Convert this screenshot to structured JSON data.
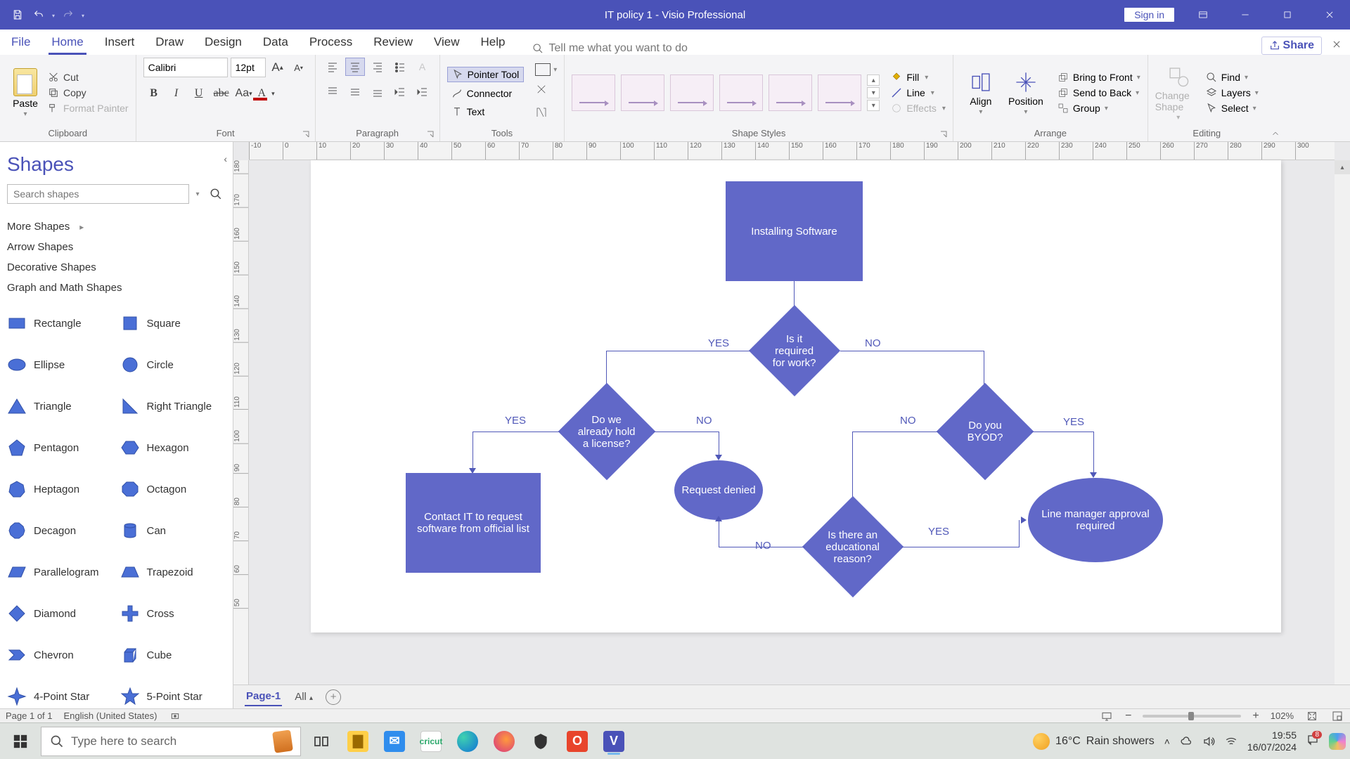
{
  "titlebar": {
    "doc_title": "IT policy 1  -  Visio Professional",
    "signin": "Sign in"
  },
  "tabs": {
    "file": "File",
    "home": "Home",
    "insert": "Insert",
    "draw": "Draw",
    "design": "Design",
    "data": "Data",
    "process": "Process",
    "review": "Review",
    "view": "View",
    "help": "Help",
    "tell_me_placeholder": "Tell me what you want to do",
    "share": "Share"
  },
  "ribbon": {
    "clipboard": {
      "label": "Clipboard",
      "paste": "Paste",
      "cut": "Cut",
      "copy": "Copy",
      "format_painter": "Format Painter"
    },
    "font": {
      "label": "Font",
      "font_name": "Calibri",
      "font_size": "12pt",
      "bold": "B",
      "italic": "I",
      "underline": "U",
      "strike": "abc",
      "case": "Aa"
    },
    "paragraph": {
      "label": "Paragraph"
    },
    "tools": {
      "label": "Tools",
      "pointer": "Pointer Tool",
      "connector": "Connector",
      "text": "Text"
    },
    "styles": {
      "label": "Shape Styles",
      "fill": "Fill",
      "line": "Line",
      "effects": "Effects"
    },
    "arrange": {
      "label": "Arrange",
      "align": "Align",
      "position": "Position",
      "bring_front": "Bring to Front",
      "send_back": "Send to Back",
      "group": "Group"
    },
    "editing": {
      "label": "Editing",
      "change_shape": "Change Shape",
      "find": "Find",
      "layers": "Layers",
      "select": "Select"
    }
  },
  "shapes_pane": {
    "title": "Shapes",
    "search_placeholder": "Search shapes",
    "categories": [
      "More Shapes",
      "Arrow Shapes",
      "Decorative Shapes",
      "Graph and Math Shapes"
    ],
    "shapes": [
      "Rectangle",
      "Square",
      "Ellipse",
      "Circle",
      "Triangle",
      "Right Triangle",
      "Pentagon",
      "Hexagon",
      "Heptagon",
      "Octagon",
      "Decagon",
      "Can",
      "Parallelogram",
      "Trapezoid",
      "Diamond",
      "Cross",
      "Chevron",
      "Cube",
      "4-Point Star",
      "5-Point Star"
    ]
  },
  "pagetabs": {
    "page1": "Page-1",
    "all": "All"
  },
  "flowchart": {
    "n1": "Installing Software",
    "n2": "Is it required for work?",
    "n3": "Do we already hold a license?",
    "n4": "Do you BYOD?",
    "n5": "Contact IT to request software from official list",
    "n6": "Request denied",
    "n7": "Is there an educational reason?",
    "n8": "Line manager approval required",
    "yes": "YES",
    "no": "NO"
  },
  "status": {
    "page": "Page 1 of 1",
    "lang": "English (United States)",
    "zoom": "102%"
  },
  "taskbar": {
    "search_placeholder": "Type here to search",
    "weather_temp": "16°C",
    "weather_desc": "Rain showers",
    "time": "19:55",
    "date": "16/07/2024"
  },
  "ruler_h": [
    -10,
    0,
    10,
    20,
    30,
    40,
    50,
    60,
    70,
    80,
    90,
    100,
    110,
    120,
    130,
    140,
    150,
    160,
    170,
    180,
    190,
    200,
    210,
    220,
    230,
    240,
    250,
    260,
    270,
    280,
    290,
    300
  ],
  "ruler_v": [
    180,
    170,
    160,
    150,
    140,
    130,
    120,
    110,
    100,
    90,
    80,
    70,
    60,
    50
  ]
}
